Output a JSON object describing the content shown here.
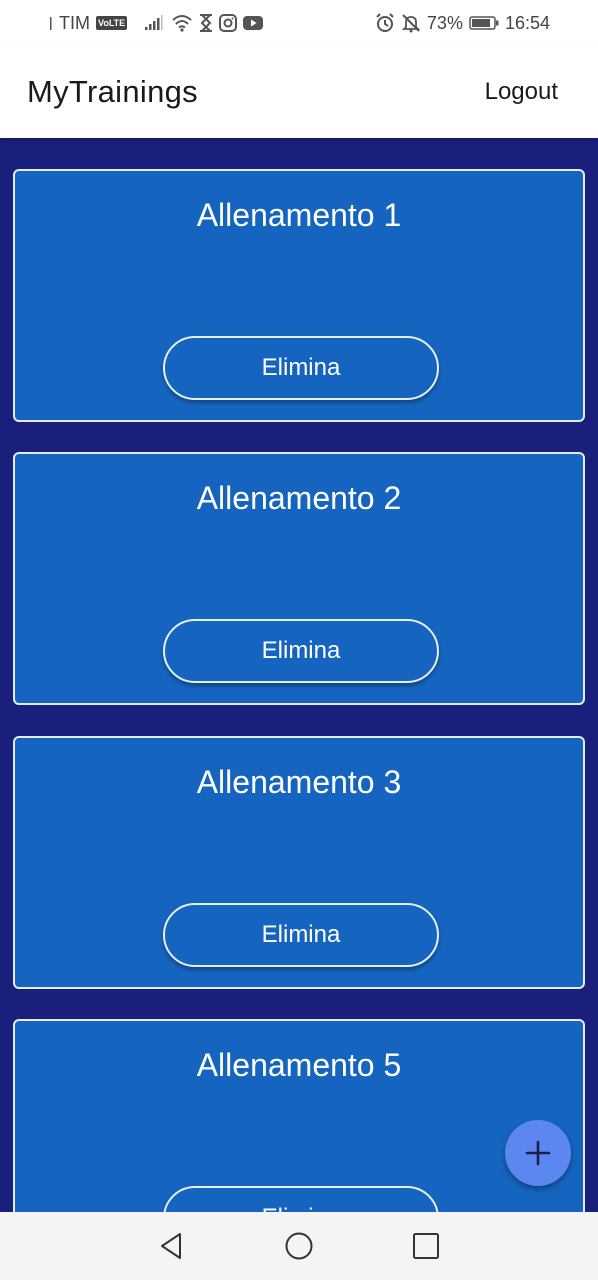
{
  "status_bar": {
    "carrier": "TIM",
    "volte_badge": "VoLTE",
    "battery_percent": "73%",
    "time": "16:54"
  },
  "app_bar": {
    "title": "MyTrainings",
    "logout_label": "Logout"
  },
  "trainings": [
    {
      "title": "Allenamento 1",
      "delete_label": "Elimina"
    },
    {
      "title": "Allenamento 2",
      "delete_label": "Elimina"
    },
    {
      "title": "Allenamento 3",
      "delete_label": "Elimina"
    },
    {
      "title": "Allenamento 5",
      "delete_label": "Elimina"
    }
  ],
  "fab": {
    "icon": "plus-icon"
  },
  "nav_bar": {
    "icons": [
      "back-triangle-icon",
      "home-circle-icon",
      "recents-square-icon"
    ]
  },
  "colors": {
    "background": "#1b1f7c",
    "card": "#1565c0",
    "fab": "#5c86f0",
    "appbar": "#ffffff"
  }
}
